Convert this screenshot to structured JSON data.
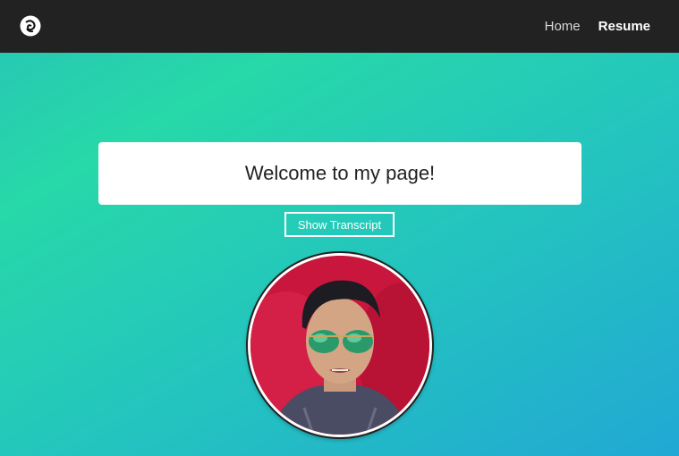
{
  "navbar": {
    "logo_icon": "spiral-logo-icon",
    "links": [
      {
        "label": "Home",
        "active": false
      },
      {
        "label": "Resume",
        "active": true
      }
    ]
  },
  "hero": {
    "welcome_text": "Welcome to my page!",
    "transcript_button_label": "Show Transcript",
    "avatar_icon": "profile-photo"
  },
  "colors": {
    "navbar_bg": "#222222",
    "gradient_start": "#27d8a8",
    "gradient_end": "#21a8d4",
    "card_bg": "#ffffff"
  }
}
